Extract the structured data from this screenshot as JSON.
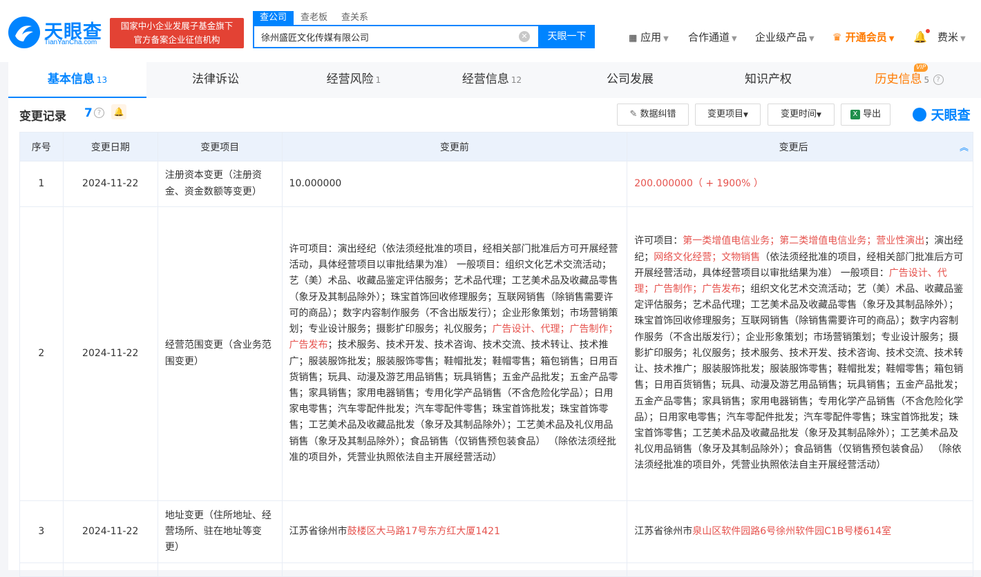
{
  "header": {
    "logo_name": "天眼查",
    "logo_sub": "TianYanCha.com",
    "badge_line1": "国家中小企业发展子基金旗下",
    "badge_line2": "官方备案企业征信机构",
    "search_tabs": [
      "查公司",
      "查老板",
      "查关系"
    ],
    "search_value": "徐州盛匠文化传媒有限公司",
    "search_button": "天眼一下",
    "nav": {
      "apps": "应用",
      "channel": "合作通道",
      "enterprise": "企业级产品",
      "vip": "开通会员",
      "user": "费米"
    }
  },
  "tabs": [
    {
      "label": "基本信息",
      "count": "13"
    },
    {
      "label": "法律诉讼",
      "count": ""
    },
    {
      "label": "经营风险",
      "count": "1"
    },
    {
      "label": "经营信息",
      "count": "12"
    },
    {
      "label": "公司发展",
      "count": ""
    },
    {
      "label": "知识产权",
      "count": ""
    },
    {
      "label": "历史信息",
      "count": "5",
      "tag": "VIP"
    }
  ],
  "section": {
    "title": "变更记录",
    "count": "7",
    "buttons": {
      "correction": "数据纠错",
      "item": "变更项目",
      "time": "变更时间",
      "export": "导出"
    },
    "watermark": "天眼查"
  },
  "table": {
    "headers": [
      "序号",
      "变更日期",
      "变更项目",
      "变更前",
      "变更后"
    ],
    "rows": [
      {
        "no": "1",
        "date": "2024-11-22",
        "item": "注册资本变更（注册资金、资金数额等变更）",
        "before": [
          {
            "t": "10.000000"
          }
        ],
        "after": [
          {
            "t": "200.000000（ + 1900% ）",
            "h": true
          }
        ]
      },
      {
        "no": "2",
        "date": "2024-11-22",
        "item": "经营范围变更（含业务范围变更）",
        "before": [
          {
            "t": "许可项目：演出经纪（依法须经批准的项目，经相关部门批准后方可开展经营活动，具体经营项目以审批结果为准） 一般项目：组织文化艺术交流活动；艺（美）术品、收藏品鉴定评估服务；艺术品代理；工艺美术品及收藏品零售（象牙及其制品除外）；珠宝首饰回收修理服务；互联网销售（除销售需要许可的商品）；数字内容制作服务（不含出版发行）；企业形象策划；市场营销策划；专业设计服务；摄影扩印服务；礼仪服务；"
          },
          {
            "t": "广告设计、代理；广告制作；广告发布",
            "h": true
          },
          {
            "t": "；技术服务、技术开发、技术咨询、技术交流、技术转让、技术推广；服装服饰批发；服装服饰零售；鞋帽批发；鞋帽零售；箱包销售；日用百货销售；玩具、动漫及游艺用品销售；玩具销售；五金产品批发；五金产品零售；家具销售；家用电器销售；专用化学产品销售（不含危险化学品）；日用家电零售；汽车零配件批发；汽车零配件零售；珠宝首饰批发；珠宝首饰零售；工艺美术品及收藏品批发（象牙及其制品除外）；工艺美术品及礼仪用品销售（象牙及其制品除外）；食品销售（仅销售预包装食品） （除依法须经批准的项目外，凭营业执照依法自主开展经营活动）"
          }
        ],
        "after": [
          {
            "t": "许可项目："
          },
          {
            "t": "第一类增值电信业务；第二类增值电信业务；营业性演出",
            "h": true
          },
          {
            "t": "；演出经纪；"
          },
          {
            "t": "网络文化经营；文物销售",
            "h": true
          },
          {
            "t": "（依法须经批准的项目，经相关部门批准后方可开展经营活动，具体经营项目以审批结果为准） 一般项目："
          },
          {
            "t": "广告设计、代理；广告制作；广告发布",
            "h": true
          },
          {
            "t": "；组织文化艺术交流活动；艺（美）术品、收藏品鉴定评估服务；艺术品代理；工艺美术品及收藏品零售（象牙及其制品除外）；珠宝首饰回收修理服务；互联网销售（除销售需要许可的商品）；数字内容制作服务（不含出版发行）；企业形象策划；市场营销策划；专业设计服务；摄影扩印服务；礼仪服务；技术服务、技术开发、技术咨询、技术交流、技术转让、技术推广；服装服饰批发；服装服饰零售；鞋帽批发；鞋帽零售；箱包销售；日用百货销售；玩具、动漫及游艺用品销售；玩具销售；五金产品批发；五金产品零售；家具销售；家用电器销售；专用化学产品销售（不含危险化学品）；日用家电零售；汽车零配件批发；汽车零配件零售；珠宝首饰批发；珠宝首饰零售；工艺美术品及收藏品批发（象牙及其制品除外）；工艺美术品及礼仪用品销售（象牙及其制品除外）；食品销售（仅销售预包装食品） （除依法须经批准的项目外，凭营业执照依法自主开展经营活动）"
          }
        ]
      },
      {
        "no": "3",
        "date": "2024-11-22",
        "item": "地址变更（住所地址、经营场所、驻在地址等变更）",
        "before": [
          {
            "t": "江苏省徐州市"
          },
          {
            "t": "鼓楼区大马路17号东方红大厦1421",
            "h": true
          }
        ],
        "after": [
          {
            "t": "江苏省徐州市"
          },
          {
            "t": "泉山区软件园路6号徐州软件园C1B号楼614室",
            "h": true
          }
        ]
      }
    ]
  },
  "colors": {
    "brand": "#0084ff",
    "highlight": "#e6534e",
    "vip": "#ff7a00",
    "badge": "#e34234"
  }
}
